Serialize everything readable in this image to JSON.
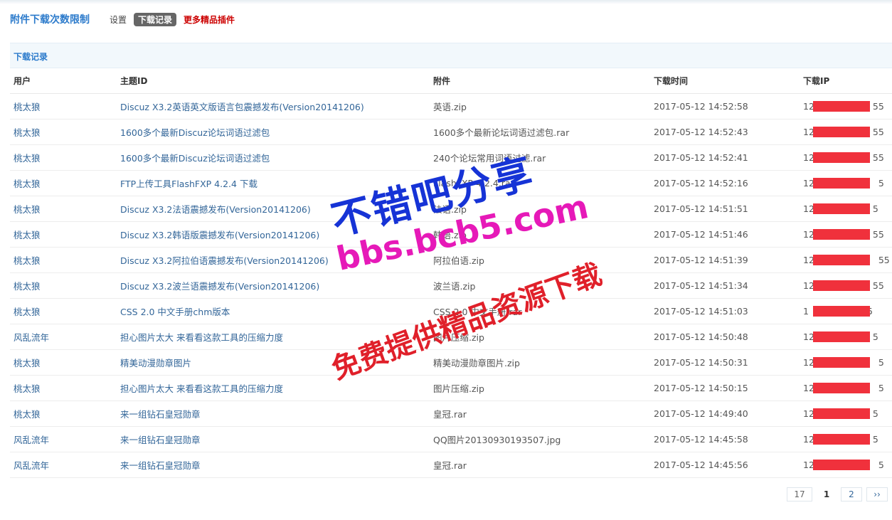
{
  "header": {
    "plugin_title": "附件下载次数限制",
    "tabs": [
      "设置",
      "下载记录",
      "更多精品插件"
    ]
  },
  "section_title": "下载记录",
  "columns": [
    "用户",
    "主题ID",
    "附件",
    "下载时间",
    "下载IP"
  ],
  "rows": [
    {
      "user": "桃太狼",
      "topic": "Discuz X3.2英语英文版语言包震撼发布(Version20141206)",
      "file": "英语.zip",
      "time": "2017-05-12 14:52:58",
      "ip_start": "12",
      "ip_end": "55"
    },
    {
      "user": "桃太狼",
      "topic": "1600多个最新Discuz论坛词语过滤包",
      "file": "1600多个最新论坛词语过滤包.rar",
      "time": "2017-05-12 14:52:43",
      "ip_start": "12",
      "ip_end": "55"
    },
    {
      "user": "桃太狼",
      "topic": "1600多个最新Discuz论坛词语过滤包",
      "file": "240个论坛常用词语过滤.rar",
      "time": "2017-05-12 14:52:41",
      "ip_start": "12",
      "ip_end": "55"
    },
    {
      "user": "桃太狼",
      "topic": "FTP上传工具FlashFXP 4.2.4 下载",
      "file": "FlashFXP 4.2.4.rar",
      "time": "2017-05-12 14:52:16",
      "ip_start": "127",
      "ip_end": "5"
    },
    {
      "user": "桃太狼",
      "topic": "Discuz X3.2法语震撼发布(Version20141206)",
      "file": "法语.zip",
      "time": "2017-05-12 14:51:51",
      "ip_start": "12",
      "ip_end": "5"
    },
    {
      "user": "桃太狼",
      "topic": "Discuz X3.2韩语版震撼发布(Version20141206)",
      "file": "韩语.zip",
      "time": "2017-05-12 14:51:46",
      "ip_start": "12",
      "ip_end": "55"
    },
    {
      "user": "桃太狼",
      "topic": "Discuz X3.2阿拉伯语震撼发布(Version20141206)",
      "file": "阿拉伯语.zip",
      "time": "2017-05-12 14:51:39",
      "ip_start": "127",
      "ip_end": "55"
    },
    {
      "user": "桃太狼",
      "topic": "Discuz X3.2波兰语震撼发布(Version20141206)",
      "file": "波兰语.zip",
      "time": "2017-05-12 14:51:34",
      "ip_start": "12",
      "ip_end": "55"
    },
    {
      "user": "桃太狼",
      "topic": "CSS 2.0 中文手册chm版本",
      "file": "CSS 2.0 中文手册.rar",
      "time": "2017-05-12 14:51:03",
      "ip_start": "1",
      "ip_end": "5"
    },
    {
      "user": "风乱流年",
      "topic": "担心图片太大 来看看这款工具的压缩力度",
      "file": "图片压缩.zip",
      "time": "2017-05-12 14:50:48",
      "ip_start": "12",
      "ip_end": "5"
    },
    {
      "user": "桃太狼",
      "topic": "精美动漫勋章图片",
      "file": "精美动漫勋章图片.zip",
      "time": "2017-05-12 14:50:31",
      "ip_start": "127",
      "ip_end": "5"
    },
    {
      "user": "桃太狼",
      "topic": "担心图片太大 来看看这款工具的压缩力度",
      "file": "图片压缩.zip",
      "time": "2017-05-12 14:50:15",
      "ip_start": "127",
      "ip_end": "5"
    },
    {
      "user": "桃太狼",
      "topic": "来一组钻石皇冠勋章",
      "file": "皇冠.rar",
      "time": "2017-05-12 14:49:40",
      "ip_start": "12",
      "ip_end": "5"
    },
    {
      "user": "风乱流年",
      "topic": "来一组钻石皇冠勋章",
      "file": "QQ图片20130930193507.jpg",
      "time": "2017-05-12 14:45:58",
      "ip_start": "12",
      "ip_end": "5"
    },
    {
      "user": "风乱流年",
      "topic": "来一组钻石皇冠勋章",
      "file": "皇冠.rar",
      "time": "2017-05-12 14:45:56",
      "ip_start": "127",
      "ip_end": "5"
    }
  ],
  "pagination": {
    "total": "17",
    "current": "1",
    "next_page": "2",
    "next": "››"
  },
  "watermark": {
    "line1": "不错吧分享",
    "line2": "bbs.bcb5.com",
    "line3": "免费提供精品资源下载"
  },
  "colors": {
    "link": "#336699",
    "title_blue": "#2b7acb",
    "active_tab": "#666666",
    "more_red": "#cc0000",
    "ip_mask": "#f0313c"
  }
}
